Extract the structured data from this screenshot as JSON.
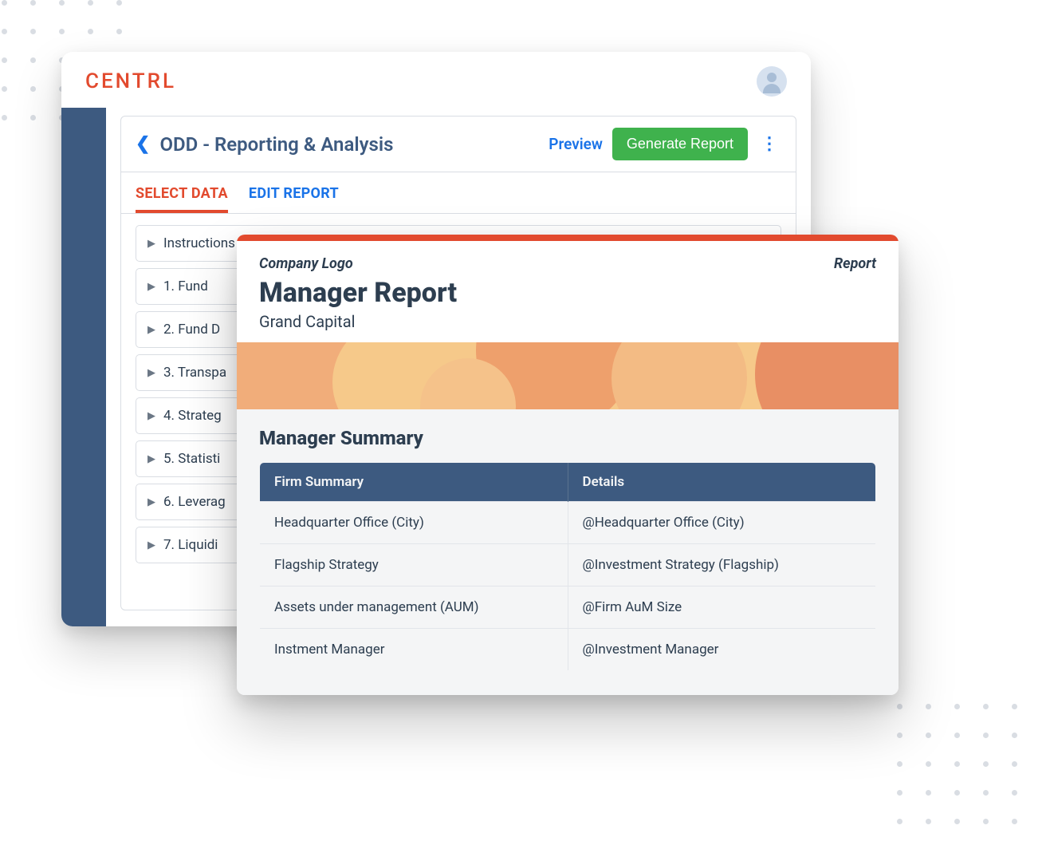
{
  "header": {
    "logo_text": "CENTRL"
  },
  "panel": {
    "page_title": "ODD - Reporting & Analysis",
    "preview_label": "Preview",
    "generate_label": "Generate Report"
  },
  "tabs": {
    "select_data": "SELECT DATA",
    "edit_report": "EDIT REPORT"
  },
  "sections": [
    {
      "label": "Instructions"
    },
    {
      "label": "1. Fund"
    },
    {
      "label": "2. Fund D"
    },
    {
      "label": "3. Transpa"
    },
    {
      "label": "4. Strateg"
    },
    {
      "label": "5. Statisti"
    },
    {
      "label": "6. Leverag"
    },
    {
      "label": "7. Liquidi"
    }
  ],
  "report": {
    "company_logo_label": "Company Logo",
    "report_label": "Report",
    "title": "Manager Report",
    "subtitle": "Grand Capital",
    "summary_title": "Manager Summary",
    "table_headers": {
      "col1": "Firm Summary",
      "col2": "Details"
    },
    "rows": [
      {
        "firm": "Headquarter Office (City)",
        "detail": "@Headquarter Office (City)"
      },
      {
        "firm": "Flagship Strategy",
        "detail": "@Investment Strategy (Flagship)"
      },
      {
        "firm": "Assets under management (AUM)",
        "detail": "@Firm AuM Size"
      },
      {
        "firm": "Instment Manager",
        "detail": "@Investment Manager"
      }
    ]
  }
}
